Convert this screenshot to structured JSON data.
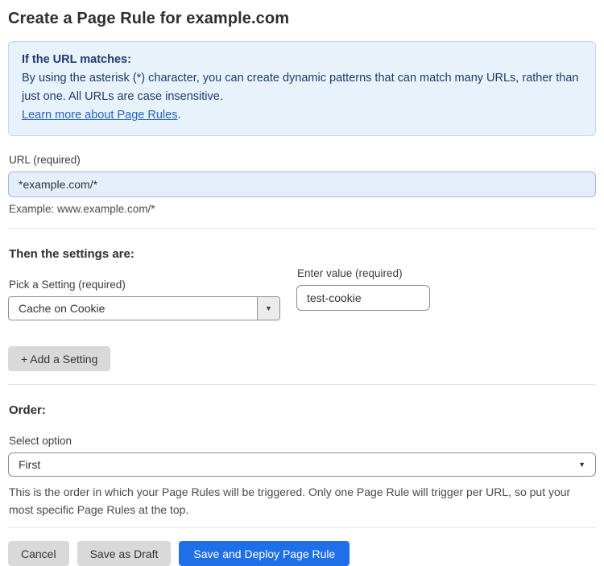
{
  "page": {
    "title": "Create a Page Rule for example.com"
  },
  "info_box": {
    "heading": "If the URL matches:",
    "body": "By using the asterisk (*) character, you can create dynamic patterns that can match many URLs, rather than just one. All URLs are case insensitive.",
    "link_label": "Learn more about Page Rules",
    "link_suffix": "."
  },
  "url_field": {
    "label": "URL (required)",
    "value": "*example.com/*",
    "example": "Example: www.example.com/*"
  },
  "settings": {
    "heading": "Then the settings are:",
    "setting_label": "Pick a Setting (required)",
    "setting_selected": "Cache on Cookie",
    "value_label": "Enter value (required)",
    "value": "test-cookie",
    "add_button_label": "+ Add a Setting"
  },
  "order": {
    "heading": "Order:",
    "select_label": "Select option",
    "selected_option": "First",
    "help_text": "This is the order in which your Page Rules will be triggered. Only one Page Rule will trigger per URL, so put your most specific Page Rules at the top."
  },
  "footer": {
    "cancel_label": "Cancel",
    "save_draft_label": "Save as Draft",
    "save_deploy_label": "Save and Deploy Page Rule"
  },
  "icons": {
    "dropdown_arrow": "▼"
  },
  "colors": {
    "accent_blue": "#1f6fe8",
    "info_box_bg": "#e8f2fb",
    "info_box_border": "#bcd9f1",
    "info_text": "#1e3c6e",
    "link_blue": "#2563c4",
    "url_input_bg": "#e5eefb",
    "url_input_border": "#a2b8d8",
    "gray_button_bg": "#d9d9d9"
  }
}
